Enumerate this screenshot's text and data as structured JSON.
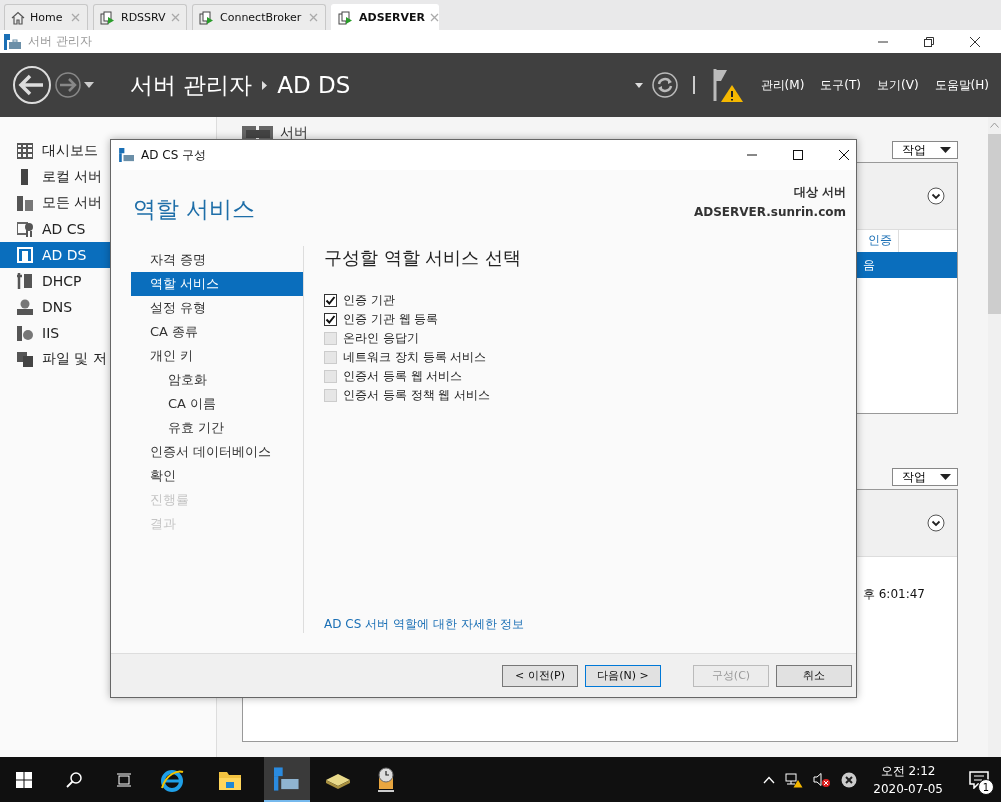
{
  "browser_tabs": [
    {
      "label": "Home",
      "selected": false,
      "kind": "home"
    },
    {
      "label": "RDSSRV",
      "selected": false,
      "kind": "server"
    },
    {
      "label": "ConnectBroker",
      "selected": false,
      "kind": "server"
    },
    {
      "label": "ADSERVER",
      "selected": true,
      "kind": "server"
    }
  ],
  "window": {
    "title": "서버 관리자"
  },
  "header": {
    "breadcrumb": [
      "서버 관리자",
      "AD DS"
    ],
    "menus": [
      "관리(M)",
      "도구(T)",
      "보기(V)",
      "도움말(H)"
    ]
  },
  "sidebar": {
    "items": [
      {
        "label": "대시보드",
        "selected": false,
        "kind": "dashboard"
      },
      {
        "label": "로컬 서버",
        "selected": false,
        "kind": "local"
      },
      {
        "label": "모든 서버",
        "selected": false,
        "kind": "all"
      },
      {
        "label": "AD CS",
        "selected": false,
        "kind": "cert"
      },
      {
        "label": "AD DS",
        "selected": true,
        "kind": "adds"
      },
      {
        "label": "DHCP",
        "selected": false,
        "kind": "dhcp"
      },
      {
        "label": "DNS",
        "selected": false,
        "kind": "dns"
      },
      {
        "label": "IIS",
        "selected": false,
        "kind": "iis"
      },
      {
        "label": "파일 및 저",
        "selected": false,
        "kind": "files"
      }
    ]
  },
  "main": {
    "heading": "서버",
    "sections": [
      {
        "tasks": "작업",
        "column": "인증",
        "cell": "음",
        "cell_selected": true
      },
      {
        "tasks": "작업",
        "cell": "후 6:01:47",
        "cell_selected": false
      }
    ]
  },
  "dialog": {
    "title": "AD CS 구성",
    "heading": "역할 서비스",
    "target_label": "대상 서버",
    "target_value": "ADSERVER.sunrin.com",
    "steps": [
      {
        "label": "자격 증명",
        "selected": false,
        "disabled": false
      },
      {
        "label": "역할 서비스",
        "selected": true,
        "disabled": false
      },
      {
        "label": "설정 유형",
        "selected": false,
        "disabled": false
      },
      {
        "label": "CA 종류",
        "selected": false,
        "disabled": false
      },
      {
        "label": "개인 키",
        "selected": false,
        "disabled": false,
        "children": [
          {
            "label": "암호화",
            "selected": false,
            "disabled": false
          },
          {
            "label": "CA 이름",
            "selected": false,
            "disabled": false
          },
          {
            "label": "유효 기간",
            "selected": false,
            "disabled": false
          }
        ]
      },
      {
        "label": "인증서 데이터베이스",
        "selected": false,
        "disabled": false
      },
      {
        "label": "확인",
        "selected": false,
        "disabled": false
      },
      {
        "label": "진행률",
        "selected": false,
        "disabled": true
      },
      {
        "label": "결과",
        "selected": false,
        "disabled": true
      }
    ],
    "content_heading": "구성할 역할 서비스 선택",
    "roles": [
      {
        "label": "인증 기관",
        "checked": true,
        "disabled": false
      },
      {
        "label": "인증 기관 웹 등록",
        "checked": true,
        "disabled": false
      },
      {
        "label": "온라인 응답기",
        "checked": false,
        "disabled": true
      },
      {
        "label": "네트워크 장치 등록 서비스",
        "checked": false,
        "disabled": true
      },
      {
        "label": "인증서 등록 웹 서비스",
        "checked": false,
        "disabled": true
      },
      {
        "label": "인증서 등록 정책 웹 서비스",
        "checked": false,
        "disabled": true
      }
    ],
    "link": "AD CS 서버 역할에 대한 자세한 정보",
    "buttons": [
      {
        "label": "< 이전(P)",
        "disabled": false,
        "focused": false
      },
      {
        "label": "다음(N) >",
        "disabled": false,
        "focused": true
      },
      {
        "label": "구성(C)",
        "disabled": true,
        "focused": false
      },
      {
        "label": "취소",
        "disabled": false,
        "focused": false
      }
    ]
  },
  "taskbar": {
    "time": "오전 2:12",
    "date": "2020-07-05",
    "notifications": "1"
  }
}
